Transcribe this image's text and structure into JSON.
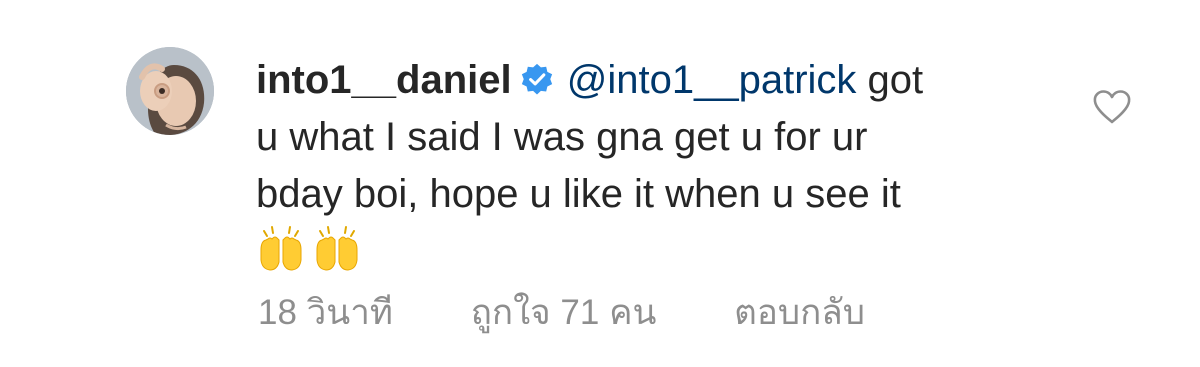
{
  "comment": {
    "username": "into1__daniel",
    "verified": true,
    "mention": "@into1__patrick",
    "text_line1": " got",
    "text_line2": "u what I said I was gna get u for ur",
    "text_line3": "bday boi, hope u like it when u see it",
    "emoji": "raising-hands",
    "emoji_count": 2,
    "time": "18 วินาที",
    "likes": "ถูกใจ 71 คน",
    "reply": "ตอบกลับ"
  },
  "colors": {
    "username": "#262626",
    "text": "#262626",
    "mention": "#00376b",
    "meta": "#8e8e8e",
    "verified_badge": "#3897f0",
    "heart_outline": "#8e8e8e",
    "emoji": "#ffcc33"
  },
  "icons": {
    "verified": "verified-badge-icon",
    "like": "heart-outline-icon",
    "emoji": "raising-hands-emoji"
  }
}
